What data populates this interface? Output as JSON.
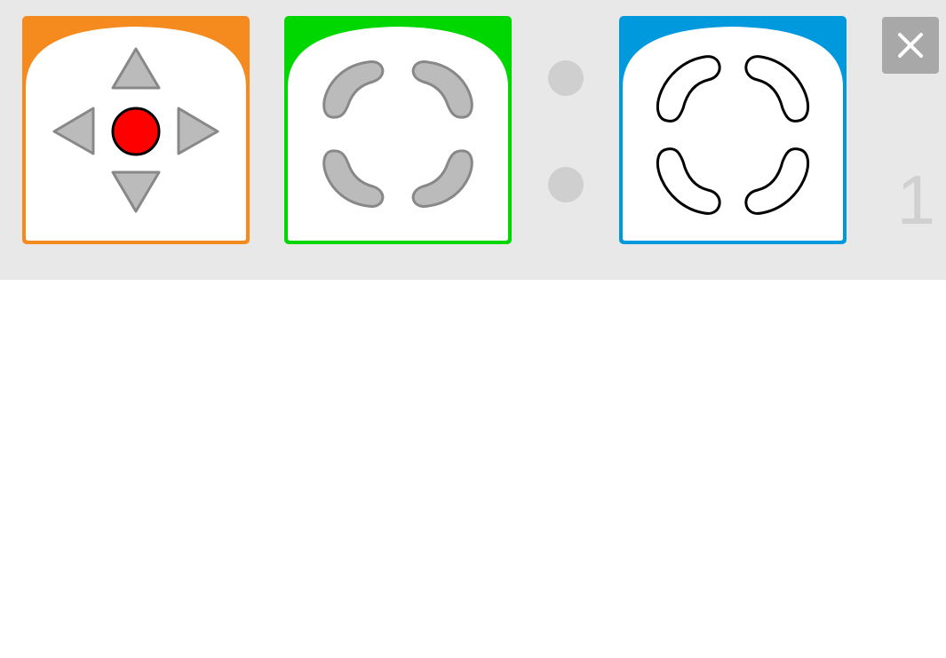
{
  "theme": {
    "toolbar_bg": "#e8e8e8",
    "canvas_bg": "#ffffff",
    "dot_color": "#cfcfcf",
    "page_number_color": "#d0d0d0",
    "close_bg": "#a8a8a8",
    "close_fg": "#ffffff"
  },
  "blocks": [
    {
      "id": "event-directional-block",
      "color": "#f58a1f",
      "icon": "dpad-icon",
      "icon_fill": "#bbbbbb",
      "icon_stroke": "#888888",
      "center_fill": "#ff0000",
      "center_stroke": "#000000"
    },
    {
      "id": "wheels-block",
      "color": "#00d600",
      "icon": "wheels-icon",
      "icon_fill": "#bbbbbb",
      "icon_stroke": "#888888"
    },
    {
      "id": "wheels-outline-block",
      "color": "#0099dd",
      "icon": "wheels-outline-icon",
      "icon_fill": "#ffffff",
      "icon_stroke": "#000000"
    }
  ],
  "close_button": {
    "icon": "close-icon"
  },
  "page_number": "1"
}
